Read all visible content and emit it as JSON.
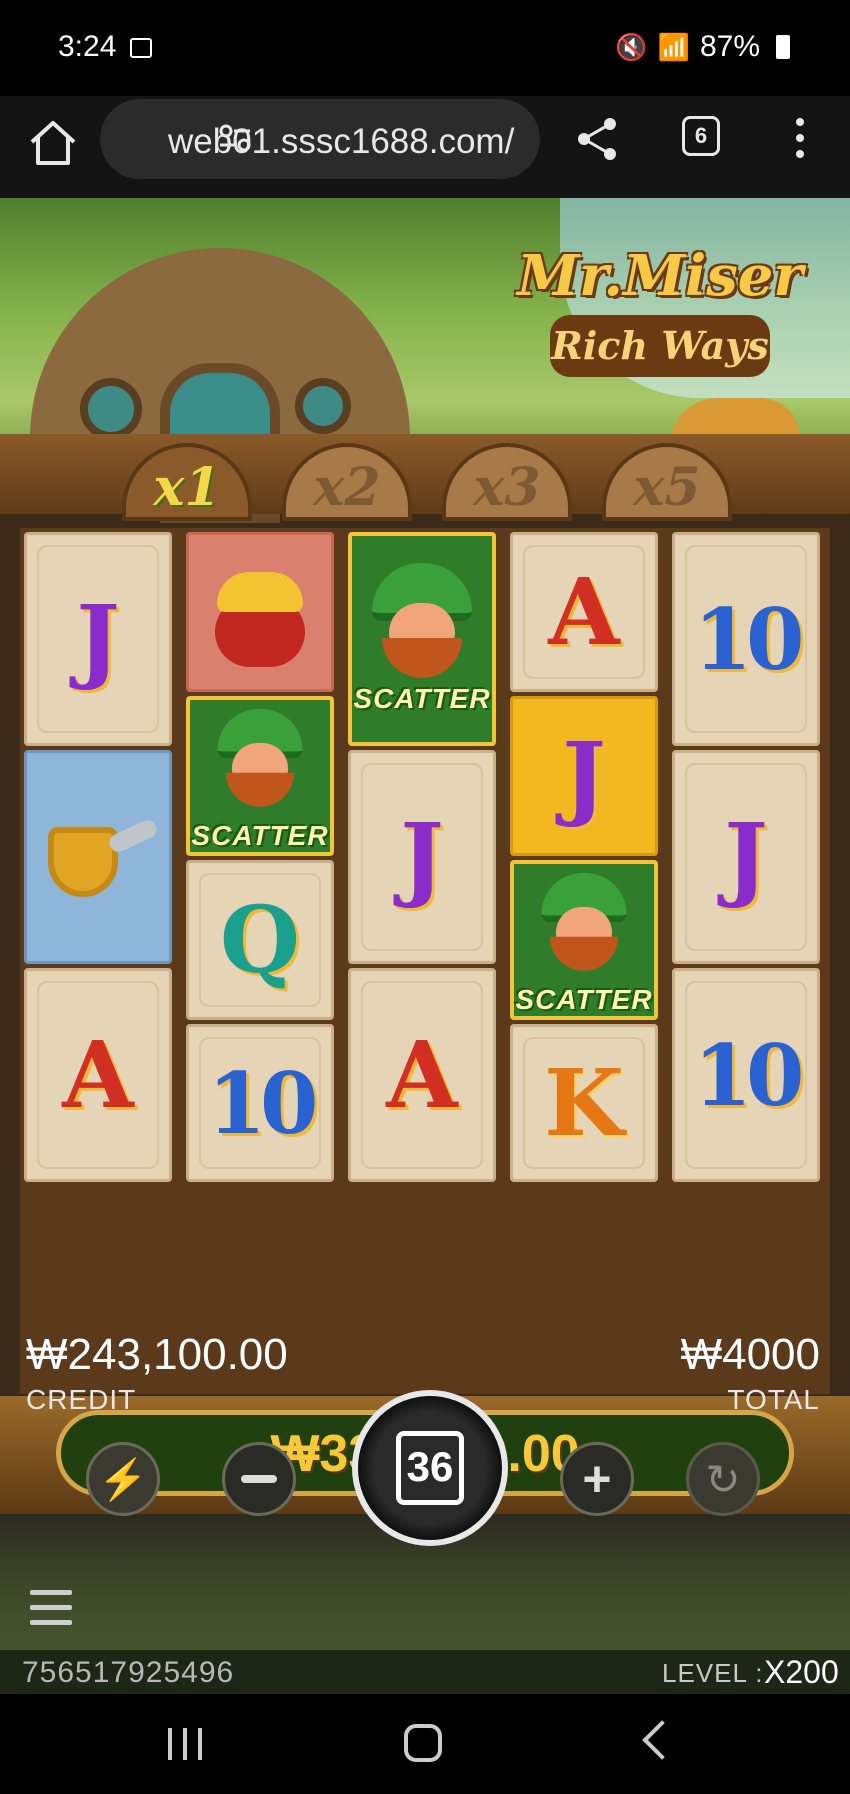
{
  "status_bar": {
    "time": "3:24",
    "battery": "87%",
    "icons": [
      "image-icon",
      "mute-icon",
      "wifi-icon",
      "hd-voice-icon",
      "signal-icon",
      "battery-icon"
    ]
  },
  "browser": {
    "url": "web01.sssc1688.com/",
    "tab_count": "6"
  },
  "game": {
    "logo_title": "Mr.Miser",
    "logo_subtitle": "Rich Ways",
    "multipliers": [
      "x1",
      "x2",
      "x3",
      "x5"
    ],
    "active_multiplier": "x1",
    "win_amount": "₩333,600.00",
    "credit_value": "₩243,100.00",
    "credit_label": "CREDIT",
    "total_value": "₩4000",
    "total_label": "TOTAL",
    "spin_count": "36",
    "game_id": "756517925496",
    "level_label": "LEVEL :",
    "level_value": "X200",
    "scatter_label": "SCATTER",
    "reels": [
      [
        "J",
        "pipe",
        "A"
      ],
      [
        "pot",
        "scatter",
        "Q",
        "10"
      ],
      [
        "scatter",
        "J",
        "A"
      ],
      [
        "A",
        "J",
        "scatter",
        "K"
      ],
      [
        "10",
        "J",
        "10"
      ]
    ]
  },
  "colors": {
    "win_text": "#f6c93a",
    "win_pill": "#21400f",
    "frame_wood": "#8a5a2a"
  }
}
